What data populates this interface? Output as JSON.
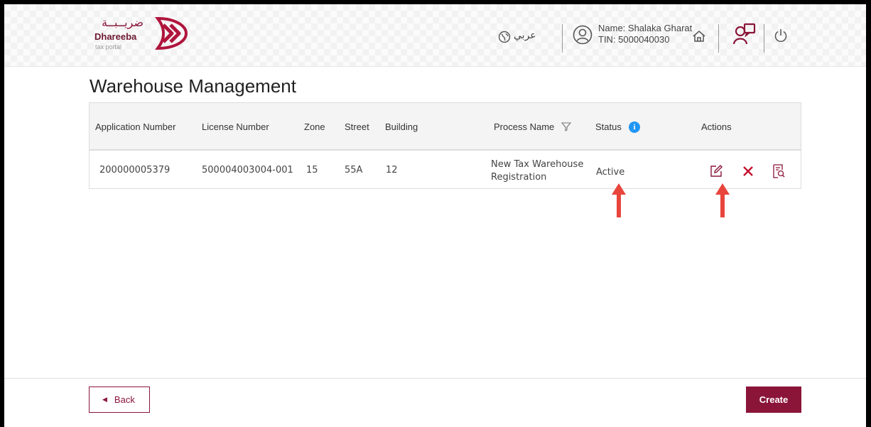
{
  "brand": {
    "arabic_name": "ضريــبــة",
    "name": "Dhareeba",
    "tagline": "tax portal",
    "color": "#8a1538"
  },
  "header": {
    "language_label": "عربي",
    "user_name": "Name: Shalaka Gharat",
    "user_tin": "TIN: 5000040030",
    "icons": [
      "globe-icon",
      "user-icon",
      "home-icon",
      "help-icon",
      "power-icon"
    ]
  },
  "page": {
    "title": "Warehouse Management"
  },
  "table": {
    "columns": {
      "application_number": "Application Number",
      "license_number": "License Number",
      "zone": "Zone",
      "street": "Street",
      "building": "Building",
      "process_name": "Process Name",
      "status": "Status",
      "actions": "Actions"
    },
    "rows": [
      {
        "application_number": "200000005379",
        "license_number": "500004003004-001",
        "zone": "15",
        "street": "55A",
        "building": "12",
        "process_name_line1": "New Tax Warehouse",
        "process_name_line2": "Registration",
        "status": "Active",
        "actions": [
          "edit-icon",
          "cancel-icon",
          "view-document-icon"
        ]
      }
    ]
  },
  "footer": {
    "back_label": "Back",
    "create_label": "Create"
  },
  "colors": {
    "accent": "#8a1538",
    "annotation_arrow": "#e8453c",
    "info": "#2196f3"
  }
}
